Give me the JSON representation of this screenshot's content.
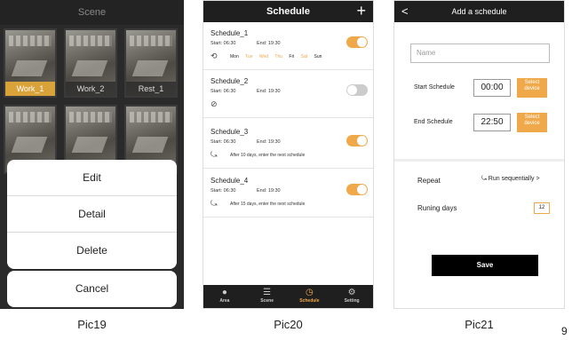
{
  "pic19": {
    "title": "Scene",
    "tiles": [
      "Work_1",
      "Work_2",
      "Rest_1",
      "",
      "",
      ""
    ],
    "menu": [
      "Edit",
      "Detail",
      "Delete"
    ],
    "cancel": "Cancel"
  },
  "pic20": {
    "title": "Schedule",
    "plus": "+",
    "schedules": [
      {
        "name": "Schedule_1",
        "start": "Start: 06:30",
        "end": "End: 19:30",
        "days": [
          "Mon",
          "Tue",
          "Wed",
          "Thu",
          "Fri",
          "Sat",
          "Sun"
        ],
        "on": true
      },
      {
        "name": "Schedule_2",
        "start": "Start: 06:30",
        "end": "End: 19:30",
        "on": false
      },
      {
        "name": "Schedule_3",
        "start": "Start: 06:30",
        "end": "End: 19:30",
        "desc": "After 10 days, enter the next schedule",
        "on": true
      },
      {
        "name": "Schedule_4",
        "start": "Start: 06:30",
        "end": "End: 19:30",
        "desc": "After 15 days, enter the next schedule",
        "on": true
      }
    ],
    "tabs": [
      "Area",
      "Scene",
      "Schedule",
      "Setting"
    ]
  },
  "pic21": {
    "title": "Add a schedule",
    "name_placeholder": "Name",
    "start_label": "Start Schedule",
    "start_time": "00:00",
    "end_label": "End Schedule",
    "end_time": "22:50",
    "select_device": "Select device",
    "repeat_label": "Repeat",
    "repeat_value": "Run sequentially",
    "runing_label": "Runing days",
    "runing_value": "12",
    "save": "Save"
  },
  "captions": [
    "Pic19",
    "Pic20",
    "Pic21"
  ],
  "page_number": "9",
  "colors": {
    "accent": "#f0a94a",
    "dark": "#1f1f1f"
  }
}
